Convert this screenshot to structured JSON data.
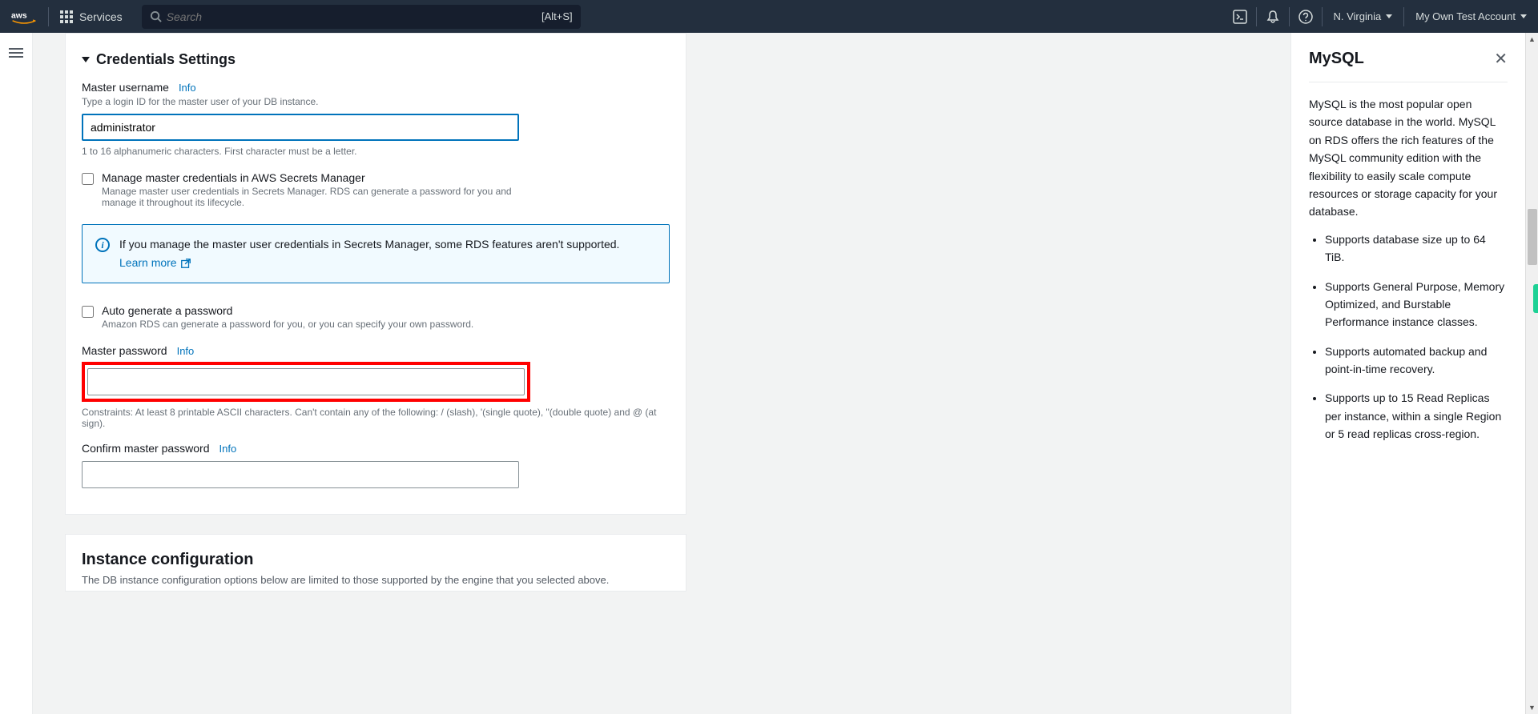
{
  "topnav": {
    "services": "Services",
    "search_placeholder": "Search",
    "search_shortcut": "[Alt+S]",
    "region": "N. Virginia",
    "account": "My Own Test Account"
  },
  "credentials": {
    "section_title": "Credentials Settings",
    "username_label": "Master username",
    "info_link": "Info",
    "username_help": "Type a login ID for the master user of your DB instance.",
    "username_value": "administrator",
    "username_constraint": "1 to 16 alphanumeric characters. First character must be a letter.",
    "secrets_label": "Manage master credentials in AWS Secrets Manager",
    "secrets_desc": "Manage master user credentials in Secrets Manager. RDS can generate a password for you and manage it throughout its lifecycle.",
    "info_box_text": "If you manage the master user credentials in Secrets Manager, some RDS features aren't supported.",
    "learn_more": "Learn more",
    "autogen_label": "Auto generate a password",
    "autogen_desc": "Amazon RDS can generate a password for you, or you can specify your own password.",
    "password_label": "Master password",
    "password_constraint": "Constraints: At least 8 printable ASCII characters. Can't contain any of the following: / (slash), '(single quote), \"(double quote) and @ (at sign).",
    "confirm_label": "Confirm master password"
  },
  "instance_config": {
    "title": "Instance configuration",
    "subtitle": "The DB instance configuration options below are limited to those supported by the engine that you selected above."
  },
  "help": {
    "title": "MySQL",
    "body": "MySQL is the most popular open source database in the world. MySQL on RDS offers the rich features of the MySQL community edition with the flexibility to easily scale compute resources or storage capacity for your database.",
    "bullets": [
      "Supports database size up to 64 TiB.",
      "Supports General Purpose, Memory Optimized, and Burstable Performance instance classes.",
      "Supports automated backup and point-in-time recovery.",
      "Supports up to 15 Read Replicas per instance, within a single Region or 5 read replicas cross-region."
    ]
  }
}
